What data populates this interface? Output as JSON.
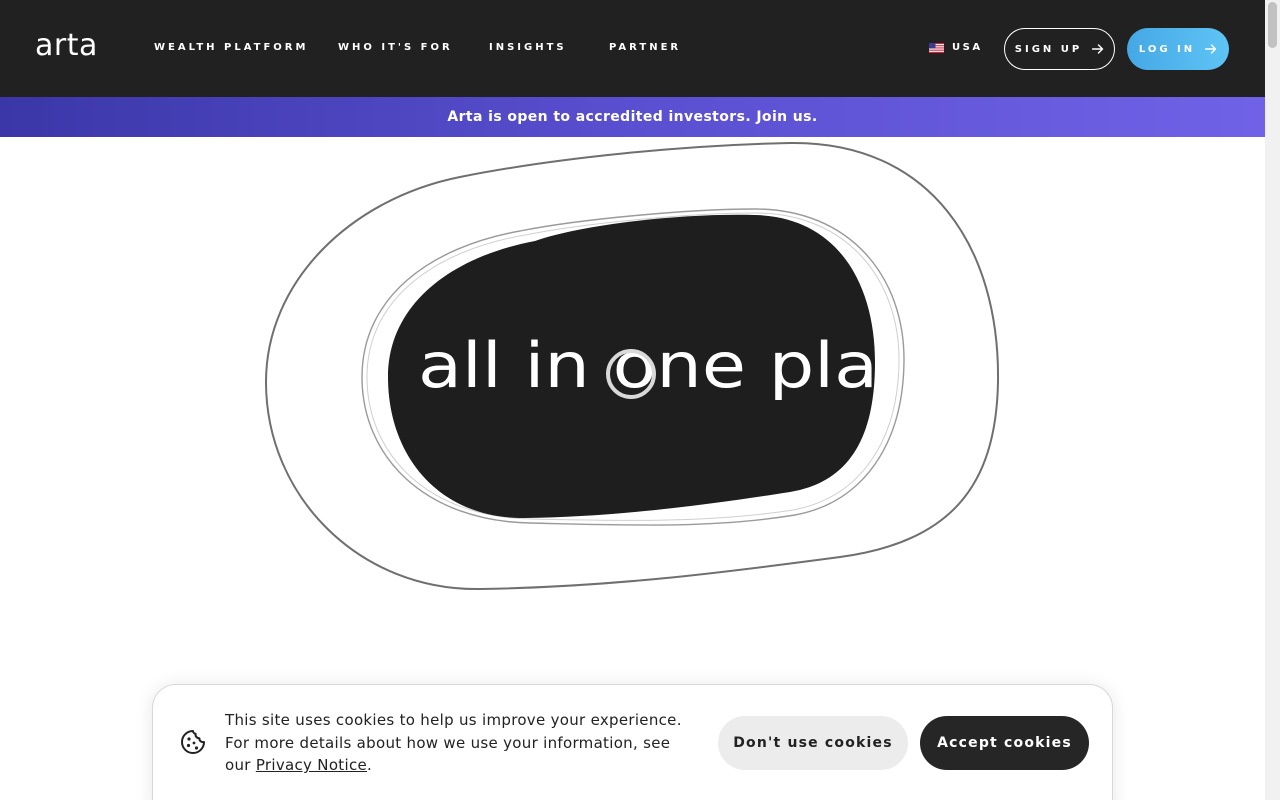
{
  "header": {
    "logo": "arta",
    "nav": [
      {
        "label": "WEALTH PLATFORM"
      },
      {
        "label": "WHO IT'S FOR"
      },
      {
        "label": "INSIGHTS"
      },
      {
        "label": "PARTNER"
      }
    ],
    "region": {
      "label": "USA",
      "icon": "us-flag-icon"
    },
    "signup_label": "SIGN UP",
    "login_label": "LOG IN",
    "arrow_icon": "arrow-right-icon"
  },
  "banner": {
    "text": "Arta is open to accredited investors. Join us."
  },
  "hero": {
    "graphic_text": "all in one pla"
  },
  "cookie": {
    "icon": "cookie-icon",
    "text_before": "This site uses cookies to help us improve your experience. For more details about how we use your information, see our ",
    "link_label": "Privacy Notice",
    "text_after": ".",
    "decline_label": "Don't use cookies",
    "accept_label": "Accept cookies"
  },
  "colors": {
    "header_bg": "#212121",
    "banner_gradient": [
      "#3b37a8",
      "#7062e6"
    ],
    "login_gradient": [
      "#45a8e6",
      "#5ec4f4"
    ],
    "accept_bg": "#262626",
    "decline_bg": "#ececec"
  }
}
